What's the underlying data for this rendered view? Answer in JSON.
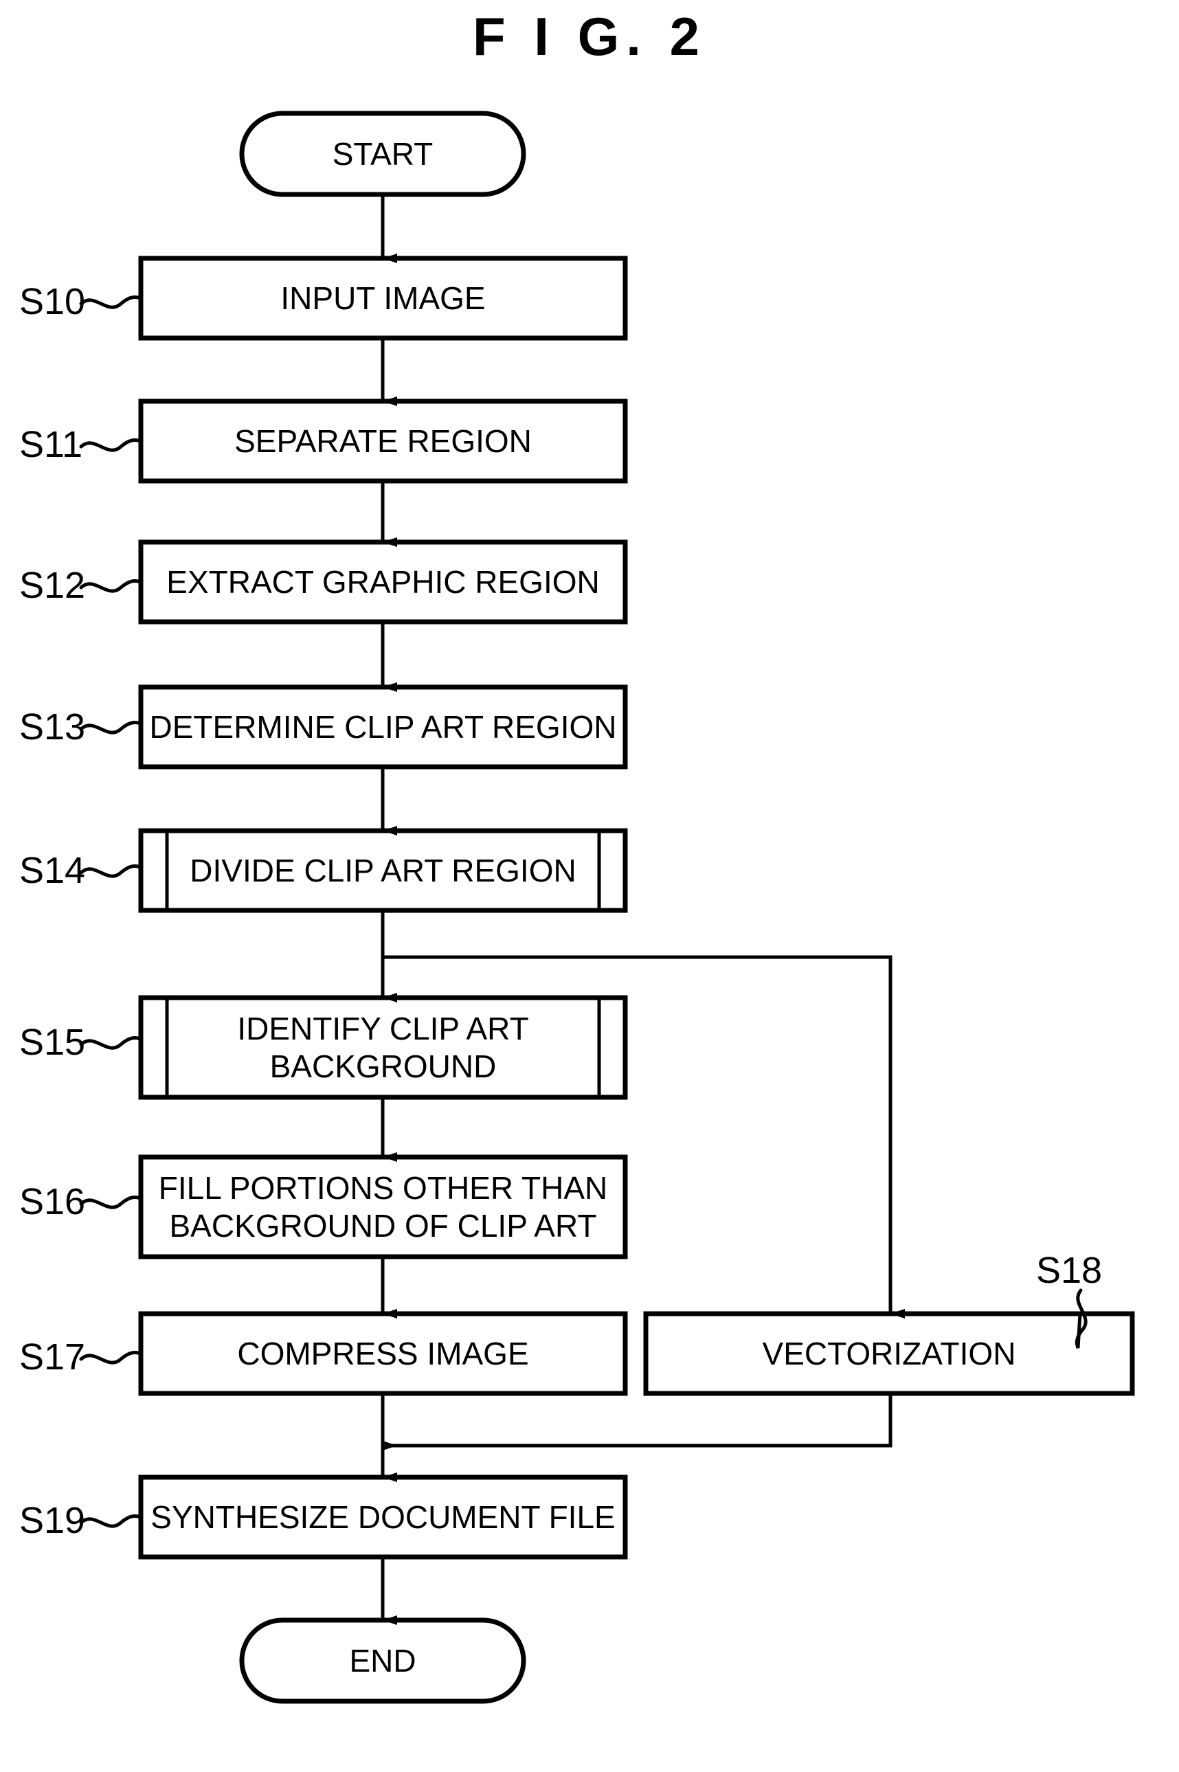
{
  "figure": {
    "title": "F I G. 2",
    "stroke_color": "#000000",
    "background_color": "#ffffff"
  },
  "terminals": {
    "start": {
      "label": "START"
    },
    "end": {
      "label": "END"
    }
  },
  "steps": [
    {
      "id": "S10",
      "step_label": "S10",
      "label": "INPUT IMAGE",
      "shape": "process"
    },
    {
      "id": "S11",
      "step_label": "S11",
      "label": "SEPARATE REGION",
      "shape": "process"
    },
    {
      "id": "S12",
      "step_label": "S12",
      "label": "EXTRACT GRAPHIC REGION",
      "shape": "process"
    },
    {
      "id": "S13",
      "step_label": "S13",
      "label": "DETERMINE CLIP ART REGION",
      "shape": "process"
    },
    {
      "id": "S14",
      "step_label": "S14",
      "label": "DIVIDE CLIP ART REGION",
      "shape": "predefined-process"
    },
    {
      "id": "S15",
      "step_label": "S15",
      "label": "IDENTIFY CLIP ART\nBACKGROUND",
      "shape": "predefined-process"
    },
    {
      "id": "S16",
      "step_label": "S16",
      "label": "FILL PORTIONS OTHER THAN\nBACKGROUND OF CLIP ART",
      "shape": "process"
    },
    {
      "id": "S17",
      "step_label": "S17",
      "label": "COMPRESS IMAGE",
      "shape": "process"
    },
    {
      "id": "S18",
      "step_label": "S18",
      "label": "VECTORIZATION",
      "shape": "process"
    },
    {
      "id": "S19",
      "step_label": "S19",
      "label": "SYNTHESIZE DOCUMENT FILE",
      "shape": "process"
    }
  ],
  "chart_data": {
    "type": "diagram",
    "title": "F I G. 2",
    "nodes": [
      {
        "id": "start",
        "text": "START",
        "shape": "terminator"
      },
      {
        "id": "S10",
        "text": "INPUT IMAGE",
        "shape": "process"
      },
      {
        "id": "S11",
        "text": "SEPARATE REGION",
        "shape": "process"
      },
      {
        "id": "S12",
        "text": "EXTRACT GRAPHIC REGION",
        "shape": "process"
      },
      {
        "id": "S13",
        "text": "DETERMINE CLIP ART REGION",
        "shape": "process"
      },
      {
        "id": "S14",
        "text": "DIVIDE CLIP ART REGION",
        "shape": "predefined-process"
      },
      {
        "id": "S15",
        "text": "IDENTIFY CLIP ART BACKGROUND",
        "shape": "predefined-process"
      },
      {
        "id": "S16",
        "text": "FILL PORTIONS OTHER THAN BACKGROUND OF CLIP ART",
        "shape": "process"
      },
      {
        "id": "S17",
        "text": "COMPRESS IMAGE",
        "shape": "process"
      },
      {
        "id": "S18",
        "text": "VECTORIZATION",
        "shape": "process"
      },
      {
        "id": "S19",
        "text": "SYNTHESIZE DOCUMENT FILE",
        "shape": "process"
      },
      {
        "id": "end",
        "text": "END",
        "shape": "terminator"
      }
    ],
    "edges": [
      {
        "from": "start",
        "to": "S10"
      },
      {
        "from": "S10",
        "to": "S11"
      },
      {
        "from": "S11",
        "to": "S12"
      },
      {
        "from": "S12",
        "to": "S13"
      },
      {
        "from": "S13",
        "to": "S14"
      },
      {
        "from": "S14",
        "to": "S15"
      },
      {
        "from": "S14",
        "to": "S18"
      },
      {
        "from": "S15",
        "to": "S16"
      },
      {
        "from": "S16",
        "to": "S17"
      },
      {
        "from": "S17",
        "to": "S19"
      },
      {
        "from": "S18",
        "to": "S19"
      },
      {
        "from": "S19",
        "to": "end"
      }
    ]
  }
}
